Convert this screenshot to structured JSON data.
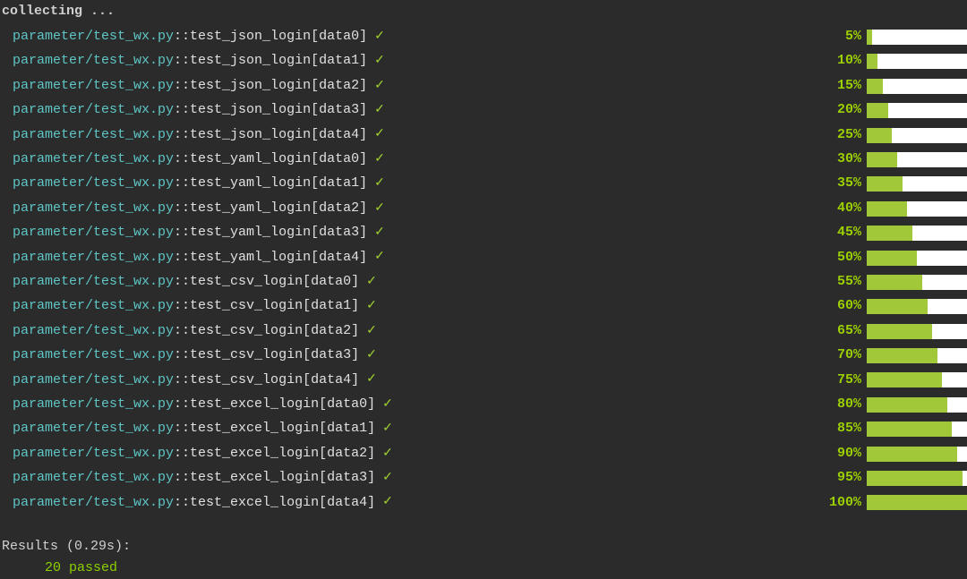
{
  "header": "collecting ...",
  "tests": [
    {
      "file": "parameter/test_wx.py",
      "sep": "::",
      "name": "test_json_login[data0]",
      "status": "✓",
      "percent": "5%",
      "bar": 6
    },
    {
      "file": "parameter/test_wx.py",
      "sep": "::",
      "name": "test_json_login[data1]",
      "status": "✓",
      "percent": "10%",
      "bar": 12
    },
    {
      "file": "parameter/test_wx.py",
      "sep": "::",
      "name": "test_json_login[data2]",
      "status": "✓",
      "percent": "15%",
      "bar": 18
    },
    {
      "file": "parameter/test_wx.py",
      "sep": "::",
      "name": "test_json_login[data3]",
      "status": "✓",
      "percent": "20%",
      "bar": 24
    },
    {
      "file": "parameter/test_wx.py",
      "sep": "::",
      "name": "test_json_login[data4]",
      "status": "✓",
      "percent": "25%",
      "bar": 28
    },
    {
      "file": "parameter/test_wx.py",
      "sep": "::",
      "name": "test_yaml_login[data0]",
      "status": "✓",
      "percent": "30%",
      "bar": 34
    },
    {
      "file": "parameter/test_wx.py",
      "sep": "::",
      "name": "test_yaml_login[data1]",
      "status": "✓",
      "percent": "35%",
      "bar": 40
    },
    {
      "file": "parameter/test_wx.py",
      "sep": "::",
      "name": "test_yaml_login[data2]",
      "status": "✓",
      "percent": "40%",
      "bar": 45
    },
    {
      "file": "parameter/test_wx.py",
      "sep": "::",
      "name": "test_yaml_login[data3]",
      "status": "✓",
      "percent": "45%",
      "bar": 51
    },
    {
      "file": "parameter/test_wx.py",
      "sep": "::",
      "name": "test_yaml_login[data4]",
      "status": "✓",
      "percent": "50%",
      "bar": 56
    },
    {
      "file": "parameter/test_wx.py",
      "sep": "::",
      "name": "test_csv_login[data0]",
      "status": "✓",
      "percent": "55%",
      "bar": 62
    },
    {
      "file": "parameter/test_wx.py",
      "sep": "::",
      "name": "test_csv_login[data1]",
      "status": "✓",
      "percent": "60%",
      "bar": 68
    },
    {
      "file": "parameter/test_wx.py",
      "sep": "::",
      "name": "test_csv_login[data2]",
      "status": "✓",
      "percent": "65%",
      "bar": 73
    },
    {
      "file": "parameter/test_wx.py",
      "sep": "::",
      "name": "test_csv_login[data3]",
      "status": "✓",
      "percent": "70%",
      "bar": 79
    },
    {
      "file": "parameter/test_wx.py",
      "sep": "::",
      "name": "test_csv_login[data4]",
      "status": "✓",
      "percent": "75%",
      "bar": 84
    },
    {
      "file": "parameter/test_wx.py",
      "sep": "::",
      "name": "test_excel_login[data0]",
      "status": "✓",
      "percent": "80%",
      "bar": 90
    },
    {
      "file": "parameter/test_wx.py",
      "sep": "::",
      "name": "test_excel_login[data1]",
      "status": "✓",
      "percent": "85%",
      "bar": 95
    },
    {
      "file": "parameter/test_wx.py",
      "sep": "::",
      "name": "test_excel_login[data2]",
      "status": "✓",
      "percent": "90%",
      "bar": 101
    },
    {
      "file": "parameter/test_wx.py",
      "sep": "::",
      "name": "test_excel_login[data3]",
      "status": "✓",
      "percent": "95%",
      "bar": 107
    },
    {
      "file": "parameter/test_wx.py",
      "sep": "::",
      "name": "test_excel_login[data4]",
      "status": "✓",
      "percent": "100%",
      "bar": 112
    }
  ],
  "results": {
    "header": "Results (0.29s):",
    "count": "20",
    "status": "passed"
  }
}
